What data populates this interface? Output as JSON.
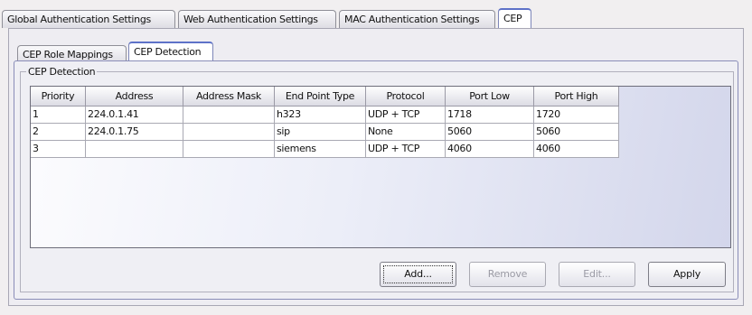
{
  "outer_tabs": [
    {
      "label": "Global Authentication Settings",
      "active": false
    },
    {
      "label": "Web Authentication Settings",
      "active": false
    },
    {
      "label": "MAC Authentication Settings",
      "active": false
    },
    {
      "label": "CEP",
      "active": true
    }
  ],
  "inner_tabs": [
    {
      "label": "CEP Role Mappings",
      "active": false
    },
    {
      "label": "CEP Detection",
      "active": true
    }
  ],
  "group": {
    "label": "CEP Detection"
  },
  "table": {
    "columns": [
      "Priority",
      "Address",
      "Address Mask",
      "End Point Type",
      "Protocol",
      "Port Low",
      "Port High"
    ],
    "rows": [
      [
        "1",
        "224.0.1.41",
        "",
        "h323",
        "UDP + TCP",
        "1718",
        "1720"
      ],
      [
        "2",
        "224.0.1.75",
        "",
        "sip",
        "None",
        "5060",
        "5060"
      ],
      [
        "3",
        "",
        "",
        "siemens",
        "UDP + TCP",
        "4060",
        "4060"
      ]
    ]
  },
  "buttons": {
    "add": "Add...",
    "remove": "Remove",
    "edit": "Edit...",
    "apply": "Apply"
  }
}
